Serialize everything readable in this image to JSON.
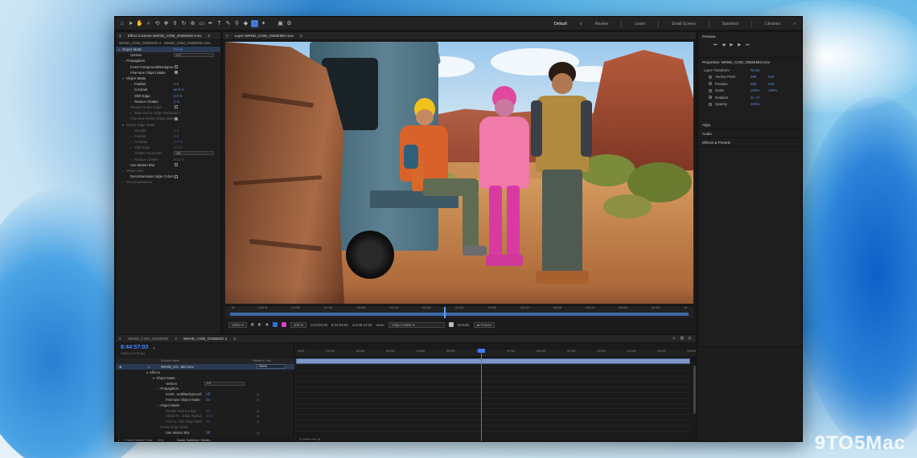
{
  "workspaces": [
    "Default",
    "Review",
    "Learn",
    "Small Screen",
    "Standard",
    "Libraries"
  ],
  "active_workspace": "Default",
  "effect_controls": {
    "tab": "Effect Controls WKND_COM_ONDEMO.mov",
    "header": "WKND_COM_ONDEMO 3 · WKND_COM_ONDEMO.mov",
    "rows": [
      {
        "label": "Object Matte",
        "value": "Reset",
        "type": "value",
        "indent": 0,
        "tw": "▾",
        "dim": false,
        "highlight": true
      },
      {
        "label": "Version",
        "value": "4.0",
        "type": "select",
        "indent": 2,
        "tw": "",
        "dim": false
      },
      {
        "label": "Propagation",
        "value": "",
        "type": "none",
        "indent": 1,
        "tw": "›",
        "dim": false
      },
      {
        "label": "Invert Foreground/Backgrou",
        "value": "",
        "type": "checkbox",
        "checked": false,
        "indent": 2,
        "tw": "",
        "dim": false
      },
      {
        "label": "Fine-tune Object Matte",
        "value": "",
        "type": "checkbox",
        "checked": true,
        "indent": 2,
        "tw": "",
        "dim": false
      },
      {
        "label": "Object Matte",
        "value": "",
        "type": "none",
        "indent": 1,
        "tw": "▾",
        "dim": false
      },
      {
        "label": "Feather",
        "value": "0.0",
        "type": "value",
        "indent": 3,
        "tw": "›",
        "dim": false
      },
      {
        "label": "Contrast",
        "value": "60.0 %",
        "type": "value",
        "indent": 3,
        "tw": "›",
        "dim": false
      },
      {
        "label": "Shift Edge",
        "value": "0.0 %",
        "type": "value",
        "indent": 3,
        "tw": "›",
        "dim": false
      },
      {
        "label": "Reduce Chatter",
        "value": "0 %",
        "type": "value",
        "indent": 3,
        "tw": "›",
        "dim": false
      },
      {
        "label": "Render Refine Edge",
        "value": "",
        "type": "checkbox",
        "checked": false,
        "indent": 2,
        "tw": "",
        "dim": true
      },
      {
        "label": "Base Refine Edge Radius",
        "value": "10.0",
        "type": "value",
        "indent": 3,
        "tw": "›",
        "dim": true
      },
      {
        "label": "Fine-tune Refine Edge Matte",
        "value": "",
        "type": "checkbox",
        "checked": true,
        "indent": 2,
        "tw": "",
        "dim": true
      },
      {
        "label": "Refine Edge Matte",
        "value": "",
        "type": "none",
        "indent": 1,
        "tw": "▾",
        "dim": true
      },
      {
        "label": "Smooth",
        "value": "0.0",
        "type": "value",
        "indent": 3,
        "tw": "›",
        "dim": true
      },
      {
        "label": "Feather",
        "value": "0.0",
        "type": "value",
        "indent": 3,
        "tw": "›",
        "dim": true
      },
      {
        "label": "Contrast",
        "value": "0.0 %",
        "type": "value",
        "indent": 3,
        "tw": "›",
        "dim": true
      },
      {
        "label": "Shift Edge",
        "value": "0.0 %",
        "type": "value",
        "indent": 3,
        "tw": "›",
        "dim": true
      },
      {
        "label": "Chatter Reduction",
        "value": "Off",
        "type": "select",
        "indent": 3,
        "tw": "",
        "dim": true
      },
      {
        "label": "Reduce Chatter",
        "value": "50.0 %",
        "type": "value",
        "indent": 3,
        "tw": "›",
        "dim": true
      },
      {
        "label": "Use Motion Blur",
        "value": "",
        "type": "checkbox",
        "checked": false,
        "indent": 2,
        "tw": "",
        "dim": false
      },
      {
        "label": "Motion Blur",
        "value": "",
        "type": "none",
        "indent": 1,
        "tw": "›",
        "dim": true
      },
      {
        "label": "Decontaminate Edge Colors",
        "value": "",
        "type": "checkbox",
        "checked": false,
        "indent": 2,
        "tw": "",
        "dim": false
      },
      {
        "label": "Decontamination",
        "value": "",
        "type": "none",
        "indent": 1,
        "tw": "›",
        "dim": true
      }
    ]
  },
  "composition": {
    "tab": "Layer WKND_COM_ONDEMO.mov",
    "mini_ticks": [
      "0f",
      "00:12f",
      "01:00f",
      "01:12f",
      "02:00f",
      "02:12f",
      "03:00f",
      "03:12f",
      "04:00f",
      "04:12f",
      "05:00f",
      "05:12f",
      "06:00f",
      "06:12f",
      "0f"
    ],
    "zoom": "100%",
    "time_1": "8:44:00:00",
    "time_2": "8:44:00:02",
    "time_3": "Δ 0:00:14:22",
    "view_label": "View:",
    "view_value": "Object Matte",
    "render_label": "Render",
    "freeze_label": "Freeze",
    "matte_color": "#d946c8"
  },
  "properties": {
    "preview_title": "Preview",
    "title": "Properties: WKND_COM_ONDEMO.mov",
    "section": "Layer Transform",
    "reset": "Reset",
    "rows": [
      {
        "label": "Anchor Point",
        "v1": "960",
        "v2": "540"
      },
      {
        "label": "Position",
        "v1": "960",
        "v2": "540"
      },
      {
        "label": "Scale",
        "v1": "100%",
        "v2": "100%"
      },
      {
        "label": "Rotation",
        "v1": "0x +0°",
        "v2": ""
      },
      {
        "label": "Opacity",
        "v1": "100%",
        "v2": ""
      }
    ],
    "collapsed": [
      "Align",
      "Audio",
      "Effects & Presets"
    ]
  },
  "timeline": {
    "tabs": [
      "WKND_COM_ONDEMO",
      "WKND_COM_ONDEMO 2"
    ],
    "time": "8:44:57:03",
    "fps": "00000 (23.976 fps)",
    "col_source": "Source Name",
    "col_parent": "Parent & Link",
    "layer_name": "WKND_CO...MO.mov",
    "layer_parent": "None",
    "ruler": [
      "0:00f",
      "01:00f",
      "02:00f",
      "03:00f",
      "04:00f",
      "05:00f",
      "06:00f",
      "07:00f",
      "08:00f",
      "01:00f",
      "02:00f",
      "03:00f",
      "04:00f",
      "05:00f"
    ],
    "rows": [
      {
        "label": "Effects",
        "value": "",
        "indent": 38,
        "dim": false,
        "type": "none",
        "tw": "▾"
      },
      {
        "label": "Object Matte",
        "value": "",
        "indent": 46,
        "dim": false,
        "type": "none",
        "tw": "▾"
      },
      {
        "label": "Version",
        "value": "4.0",
        "indent": 60,
        "dim": false,
        "type": "select",
        "tw": ""
      },
      {
        "label": "Propagation",
        "value": "",
        "indent": 52,
        "dim": false,
        "type": "none",
        "tw": "›"
      },
      {
        "label": "Invert...und/Background",
        "value": "Off",
        "indent": 60,
        "dim": false,
        "type": "value",
        "tw": ""
      },
      {
        "label": "Fine-tune Object Matte",
        "value": "On",
        "indent": 60,
        "dim": false,
        "type": "value",
        "tw": ""
      },
      {
        "label": "Object Matte",
        "value": "",
        "indent": 52,
        "dim": false,
        "type": "none",
        "tw": "›"
      },
      {
        "label": "Render Refine Edge",
        "value": "On",
        "indent": 60,
        "dim": true,
        "type": "value",
        "tw": ""
      },
      {
        "label": "Base Re...Edge Radius",
        "value": "10.0",
        "indent": 60,
        "dim": true,
        "type": "value",
        "tw": "›"
      },
      {
        "label": "Fine-tu...fine Edge Matte",
        "value": "On",
        "indent": 60,
        "dim": true,
        "type": "value",
        "tw": ""
      },
      {
        "label": "Refine Edge Matte",
        "value": "",
        "indent": 52,
        "dim": true,
        "type": "none",
        "tw": "›"
      },
      {
        "label": "Use Motion Blur",
        "value": "Off",
        "indent": 60,
        "dim": false,
        "type": "value",
        "tw": ""
      }
    ],
    "footer_label": "Frame Render Time:",
    "footer_value": "0ms",
    "toggle_label": "Toggle Switches / Modes"
  },
  "watermark": "9TO5Mac"
}
